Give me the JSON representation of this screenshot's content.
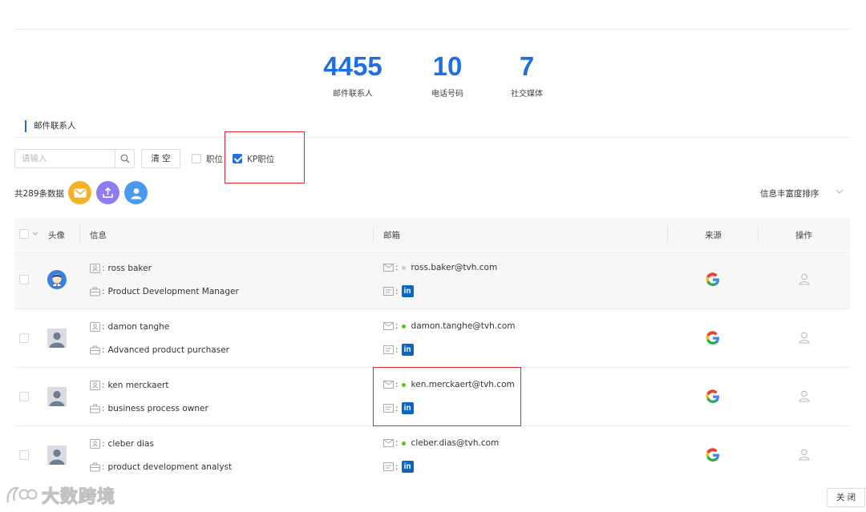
{
  "stats": [
    {
      "value": "4455",
      "label": "邮件联系人"
    },
    {
      "value": "10",
      "label": "电话号码"
    },
    {
      "value": "7",
      "label": "社交媒体"
    }
  ],
  "section_title": "邮件联系人",
  "search": {
    "placeholder": "请输入"
  },
  "clear_label": "清 空",
  "filters": {
    "position_label": "职位",
    "position_checked": false,
    "kp_label": "KP职位",
    "kp_checked": true
  },
  "count_text": "共289条数据",
  "sort_label": "信息丰富度排序",
  "table": {
    "headers": {
      "avatar": "头像",
      "info": "信息",
      "email": "邮箱",
      "source": "来源",
      "action": "操作"
    },
    "rows": [
      {
        "name": "ross baker",
        "title": "Product Development Manager",
        "email": "ross.baker@tvh.com",
        "email_status": "#cccccc",
        "source": "google",
        "avatar": "cartoon"
      },
      {
        "name": "damon tanghe",
        "title": "Advanced product purchaser",
        "email": "damon.tanghe@tvh.com",
        "email_status": "#52c41a",
        "source": "google",
        "avatar": "default"
      },
      {
        "name": "ken merckaert",
        "title": "business process owner",
        "email": "ken.merckaert@tvh.com",
        "email_status": "#52c41a",
        "source": "google",
        "avatar": "default"
      },
      {
        "name": "cleber dias",
        "title": "product development analyst",
        "email": "cleber.dias@tvh.com",
        "email_status": "#52c41a",
        "source": "google",
        "avatar": "default"
      }
    ]
  },
  "close_label": "关 闭",
  "watermark": "大数跨境",
  "colors": {
    "accent": "#1f6fe0",
    "highlight_box": "#e0282e",
    "linkedin": "#0a66c2"
  }
}
